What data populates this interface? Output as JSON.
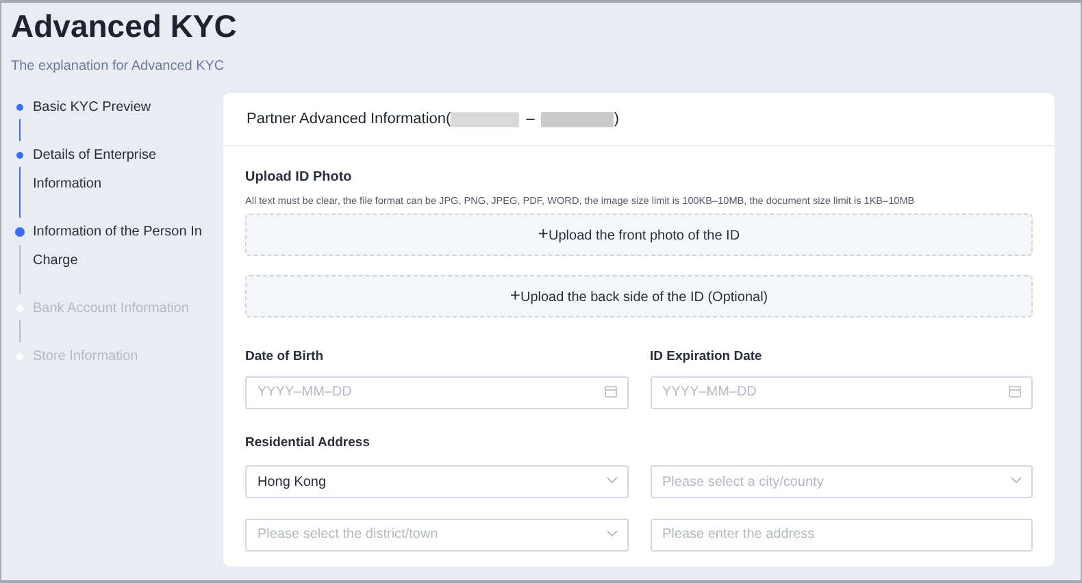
{
  "page": {
    "title": "Advanced KYC",
    "subtitle": "The explanation for Advanced KYC"
  },
  "steps": [
    {
      "label": "Basic KYC Preview",
      "completed": true,
      "selected": false
    },
    {
      "label": "Details of Enterprise Information",
      "completed": true,
      "selected": false
    },
    {
      "label": "Information of the Person In Charge",
      "completed": false,
      "selected": true
    },
    {
      "label": "Bank Account Information",
      "completed": false,
      "selected": false
    },
    {
      "label": "Store Information",
      "completed": false,
      "selected": false
    }
  ],
  "card": {
    "title_prefix": "Partner Advanced Information(",
    "separator": "–",
    "title_suffix": ")",
    "upload": {
      "label": "Upload ID Photo",
      "hint": "All text must be clear, the file format can be JPG, PNG, JPEG, PDF, WORD, the image size limit is 100KB–10MB, the document size limit is 1KB–10MB",
      "buttons": [
        {
          "plus": "+",
          "label": "Upload the front photo of the ID"
        },
        {
          "plus": "+",
          "label": "Upload the back side of the ID (Optional)"
        }
      ]
    },
    "dates": [
      {
        "label": "Date of Birth",
        "placeholder": "YYYY–MM–DD"
      },
      {
        "label": "ID Expiration Date",
        "placeholder": "YYYY–MM–DD"
      }
    ],
    "address": {
      "label": "Residential Address",
      "fields": [
        {
          "kind": "select",
          "value": "Hong Kong"
        },
        {
          "kind": "select",
          "placeholder": "Please select a city/county"
        },
        {
          "kind": "select",
          "placeholder": "Please select the district/town"
        },
        {
          "kind": "text",
          "placeholder": "Please enter the address"
        }
      ]
    }
  }
}
